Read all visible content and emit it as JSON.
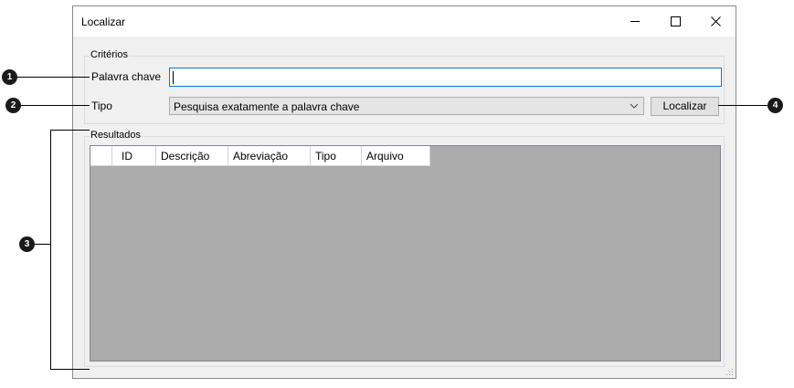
{
  "window": {
    "title": "Localizar"
  },
  "criteria": {
    "group_label": "Critérios",
    "keyword_label": "Palavra chave",
    "keyword_value": "",
    "type_label": "Tipo",
    "type_selected": "Pesquisa exatamente a palavra chave",
    "search_button": "Localizar"
  },
  "results": {
    "group_label": "Resultados",
    "columns": [
      "ID",
      "Descrição",
      "Abreviação",
      "Tipo",
      "Arquivo"
    ]
  },
  "callouts": [
    "1",
    "2",
    "3",
    "4"
  ]
}
